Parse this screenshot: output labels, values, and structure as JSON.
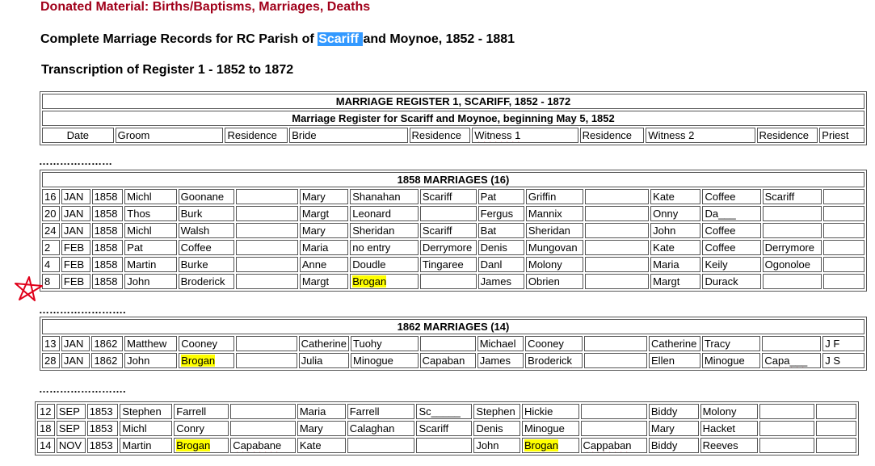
{
  "headings": {
    "donated": "Donated Material: Births/Baptisms, Marriages, Deaths",
    "complete_before": "Complete Marriage Records for RC Parish of ",
    "complete_highlight": "Scariff ",
    "complete_after": "and Moynoe, 1852 - 1881",
    "transcription": "Transcription of Register 1 - 1852 to 1872"
  },
  "register_header": {
    "title": "MARRIAGE REGISTER 1, SCARIFF, 1852 - 1872",
    "subtitle": "Marriage Register for Scariff and Moynoe, beginning May 5, 1852",
    "columns": [
      "Date",
      "Groom",
      "Residence",
      "Bride",
      "Residence",
      "Witness 1",
      "Residence",
      "Witness 2",
      "Residence",
      "Priest"
    ]
  },
  "dots": {
    "d1": "…………………",
    "d2": "…………………….",
    "d3": "…………………….",
    "d4": "…………………….",
    "d5": "| | | . |"
  },
  "section_1858": {
    "title": "1858 MARRIAGES (16)",
    "rows": [
      [
        "16",
        "JAN",
        "1858",
        "Michl",
        "Goonane",
        "",
        "Mary",
        "Shanahan",
        "Scariff",
        "Pat",
        "Griffin",
        "",
        "Kate",
        "Coffee",
        "Scariff",
        ""
      ],
      [
        "20",
        "JAN",
        "1858",
        "Thos",
        "Burk",
        "",
        "Margt",
        "Leonard",
        "",
        "Fergus",
        "Mannix",
        "",
        "Onny",
        "Da___",
        "",
        ""
      ],
      [
        "24",
        "JAN",
        "1858",
        "Michl",
        "Walsh",
        "",
        "Mary",
        "Sheridan",
        "Scariff",
        "Bat",
        "Sheridan",
        "",
        "John",
        "Coffee",
        "",
        ""
      ],
      [
        "2",
        "FEB",
        "1858",
        "Pat",
        "Coffee",
        "",
        "Maria",
        "no entry",
        "Derrymore",
        "Denis",
        "Mungovan",
        "",
        "Kate",
        "Coffee",
        "Derrymore",
        ""
      ],
      [
        "4",
        "FEB",
        "1858",
        "Martin",
        "Burke",
        "",
        "Anne",
        "Doudle",
        "Tingaree",
        "Danl",
        "Molony",
        "",
        "Maria",
        "Keily",
        "Ogonoloe",
        ""
      ],
      [
        "8",
        "FEB",
        "1858",
        "John",
        "Broderick",
        "",
        "Margt",
        "Brogan",
        "",
        "James",
        "Obrien",
        "",
        "Margt",
        "Durack",
        "",
        ""
      ]
    ]
  },
  "section_1862": {
    "title": "1862 MARRIAGES (14)",
    "rows": [
      [
        "13",
        "JAN",
        "1862",
        "Matthew",
        "Cooney",
        "",
        "Catherine",
        "Tuohy",
        "",
        "Michael",
        "Cooney",
        "",
        "Catherine",
        "Tracy",
        "",
        "J F"
      ],
      [
        "28",
        "JAN",
        "1862",
        "John",
        "Brogan",
        "",
        "Julia",
        "Minogue",
        "Capaban",
        "James",
        "Broderick",
        "",
        "Ellen",
        "Minogue",
        "Capa___",
        "J S"
      ]
    ]
  },
  "section_1853": {
    "rows": [
      [
        "12",
        "SEP",
        "1853",
        "Stephen",
        "Farrell",
        "",
        "Maria",
        "Farrell",
        "Sc_____",
        "Stephen",
        "Hickie",
        "",
        "Biddy",
        "Molony",
        "",
        ""
      ],
      [
        "18",
        "SEP",
        "1853",
        "Michl",
        "Conry",
        "",
        "Mary",
        "Calaghan",
        "Scariff",
        "Denis",
        "Minogue",
        "",
        "Mary",
        "Hacket",
        "",
        ""
      ],
      [
        "14",
        "NOV",
        "1853",
        "Martin",
        "Brogan",
        "Capabane",
        "Kate",
        "",
        "",
        "John",
        "Brogan",
        "Cappaban",
        "Biddy",
        "Reeves",
        "",
        ""
      ]
    ]
  },
  "colors": {
    "heading_red": "#a0001a",
    "selection_blue": "#3399ff",
    "highlight_yellow": "#ffff00",
    "annotation_red": "#e0001a"
  },
  "icons": {
    "annotation": "hand-drawn-star-icon"
  }
}
